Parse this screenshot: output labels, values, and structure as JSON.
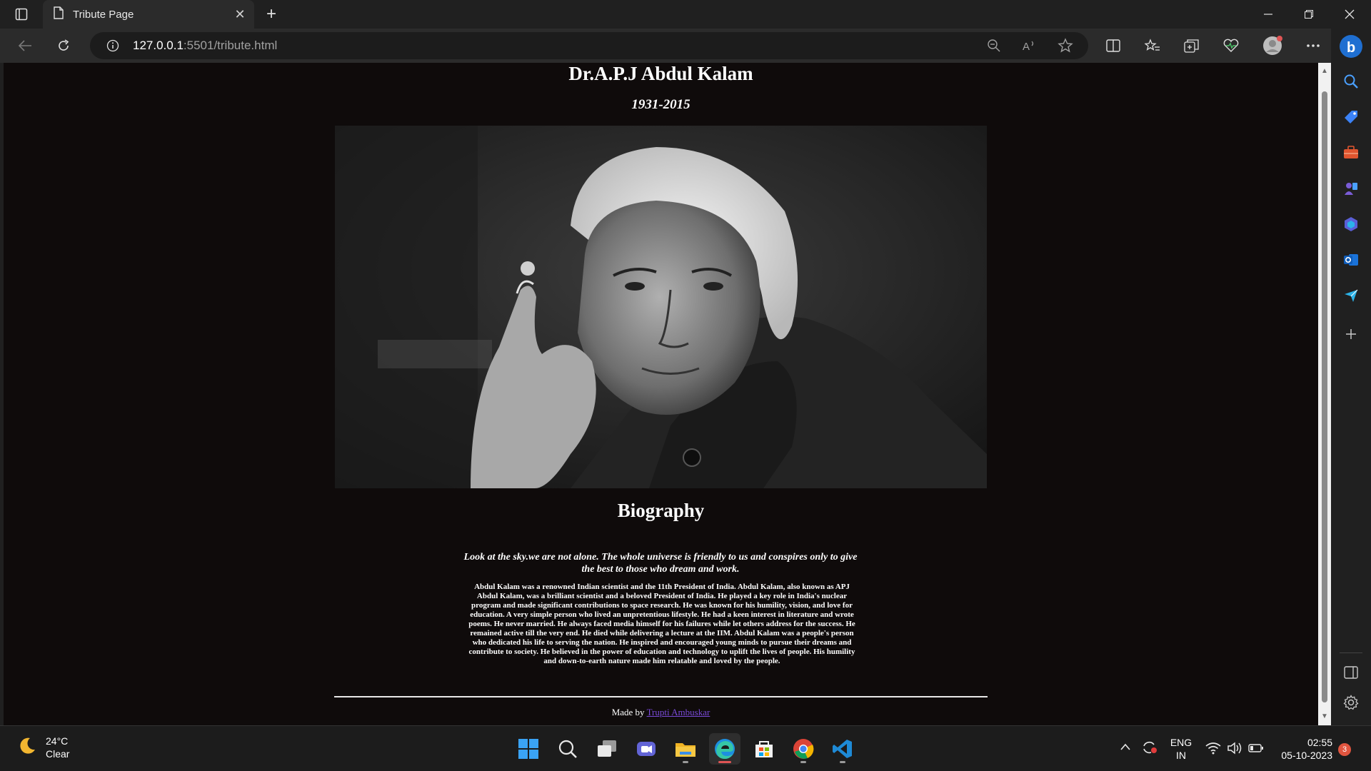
{
  "browser": {
    "tab_title": "Tribute Page",
    "url_host": "127.0.0.1",
    "url_rest": ":5501/tribute.html"
  },
  "page": {
    "title": "Dr.A.P.J Abdul Kalam",
    "dates": "1931-2015",
    "photo_alt": "Dr. A.P.J Abdul Kalam",
    "section_heading": "Biography",
    "quote": "Look at the sky.we are not alone. The whole universe is friendly to us and conspires only to give the best to those who dream and work.",
    "bio": "Abdul Kalam was a renowned Indian scientist and the 11th President of India. Abdul Kalam, also known as APJ Abdul Kalam, was a brilliant scientist and a beloved President of India. He played a key role in India's nuclear program and made significant contributions to space research. He was known for his humility, vision, and love for education. A very simple person who lived an unpretentious lifestyle. He had a keen interest in literature and wrote poems. He never married. He always faced media himself for his failures while let others address for the success. He remained active till the very end. He died while delivering a lecture at the IIM. Abdul Kalam was a people's person who dedicated his life to serving the nation. He inspired and encouraged young minds to pursue their dreams and contribute to society. He believed in the power of education and technology to uplift the lives of people. His humility and down-to-earth nature made him relatable and loved by the people.",
    "footer_prefix": "Made by",
    "footer_author": "Trupti Ambuskar"
  },
  "taskbar": {
    "temperature": "24°C",
    "condition": "Clear",
    "lang_top": "ENG",
    "lang_bottom": "IN",
    "time": "02:55",
    "date": "05-10-2023",
    "notification_count": "3"
  },
  "colors": {
    "page_bg": "#0f0b0b",
    "link": "#7a4ad8",
    "browser_chrome": "#202020"
  }
}
